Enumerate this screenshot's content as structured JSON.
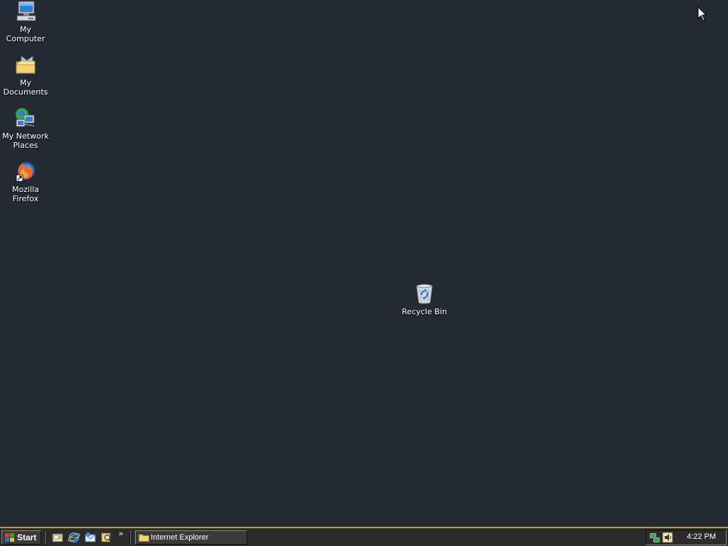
{
  "desktop": {
    "icons": [
      {
        "label": "My Computer",
        "icon": "my-computer-icon"
      },
      {
        "label": "My Documents",
        "icon": "my-documents-icon"
      },
      {
        "label": "My Network Places",
        "icon": "network-places-icon"
      },
      {
        "label": "Mozilla Firefox",
        "icon": "firefox-icon"
      },
      {
        "label": "Recycle Bin",
        "icon": "recycle-bin-icon"
      }
    ]
  },
  "taskbar": {
    "start_label": "Start",
    "quick_launch": [
      "show-desktop-icon",
      "internet-explorer-icon",
      "outlook-express-icon",
      "search-icon"
    ],
    "chevron": "»",
    "tasks": [
      {
        "label": "Internet Explorer",
        "icon": "folder-icon"
      }
    ],
    "tray_icons": [
      "network-icon",
      "volume-icon"
    ],
    "clock": "4:22 PM"
  },
  "colors": {
    "desktop_bg": "#232a33",
    "taskbar_bg": "#2b2b2b",
    "taskbar_border": "#b49b55"
  }
}
